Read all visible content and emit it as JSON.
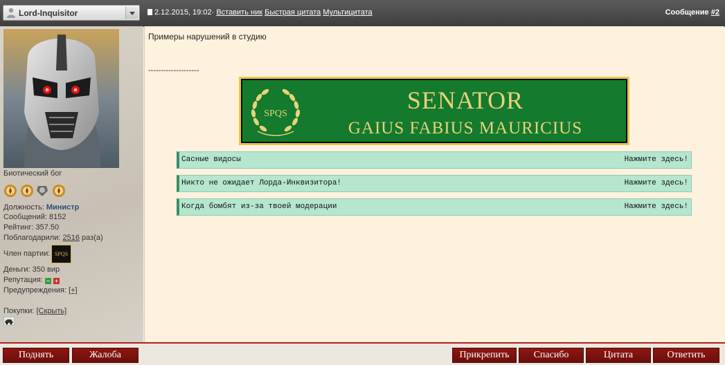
{
  "header": {
    "username": "Lord-Inquisitor",
    "post_date": "2.12.2015, 19:02",
    "separator": "·",
    "insert_nick": "Вставить ник",
    "quick_quote": "Быстрая цитата",
    "multi_quote": "Мультицитата",
    "message_label": "Сообщение",
    "message_number": "#2"
  },
  "profile": {
    "title": "Биотический бог",
    "position_label": "Должность:",
    "position_value": "Министр",
    "posts": "Сообщений: 8152",
    "rating": "Рейтинг: 357.50",
    "thanked_label": "Поблагодарили:",
    "thanked_count": "2516",
    "thanked_suffix": "раз(а)",
    "party_label": "Член партии:",
    "party_badge": "SPQS",
    "money": "Деньги: 350 вир",
    "reputation_label": "Репутация:",
    "warnings_label": "Предупреждения:",
    "warnings_link": "[+]",
    "purchases_label": "Покупки:",
    "purchases_link": "[Скрыть]"
  },
  "post": {
    "text": "Примеры нарушений в студию",
    "separator": "--------------------",
    "banner": {
      "seal": "SPQS",
      "title": "SENATOR",
      "name": "GAIUS FABIUS MAURICIUS"
    },
    "spoilers": [
      {
        "title": "Сасные видосы",
        "cta": "Нажмите здесь!"
      },
      {
        "title": "Никто не ожидает Лорда-Инквизитора!",
        "cta": "Нажмите здесь!"
      },
      {
        "title": "Когда бомбят из-за твоей модерации",
        "cta": "Нажмите здесь!"
      }
    ]
  },
  "buttons": {
    "raise": "Поднять",
    "complain": "Жалоба",
    "pin": "Прикрепить",
    "thanks": "Спасибо",
    "quote": "Цитата",
    "reply": "Ответить"
  },
  "colors": {
    "header_bg": "#4a4a4a",
    "content_bg": "#fef1de",
    "banner_green": "#137a2e",
    "banner_gold": "#e5c84a",
    "spoiler_bg": "#b6e6cf",
    "button_red": "#7d120e"
  }
}
